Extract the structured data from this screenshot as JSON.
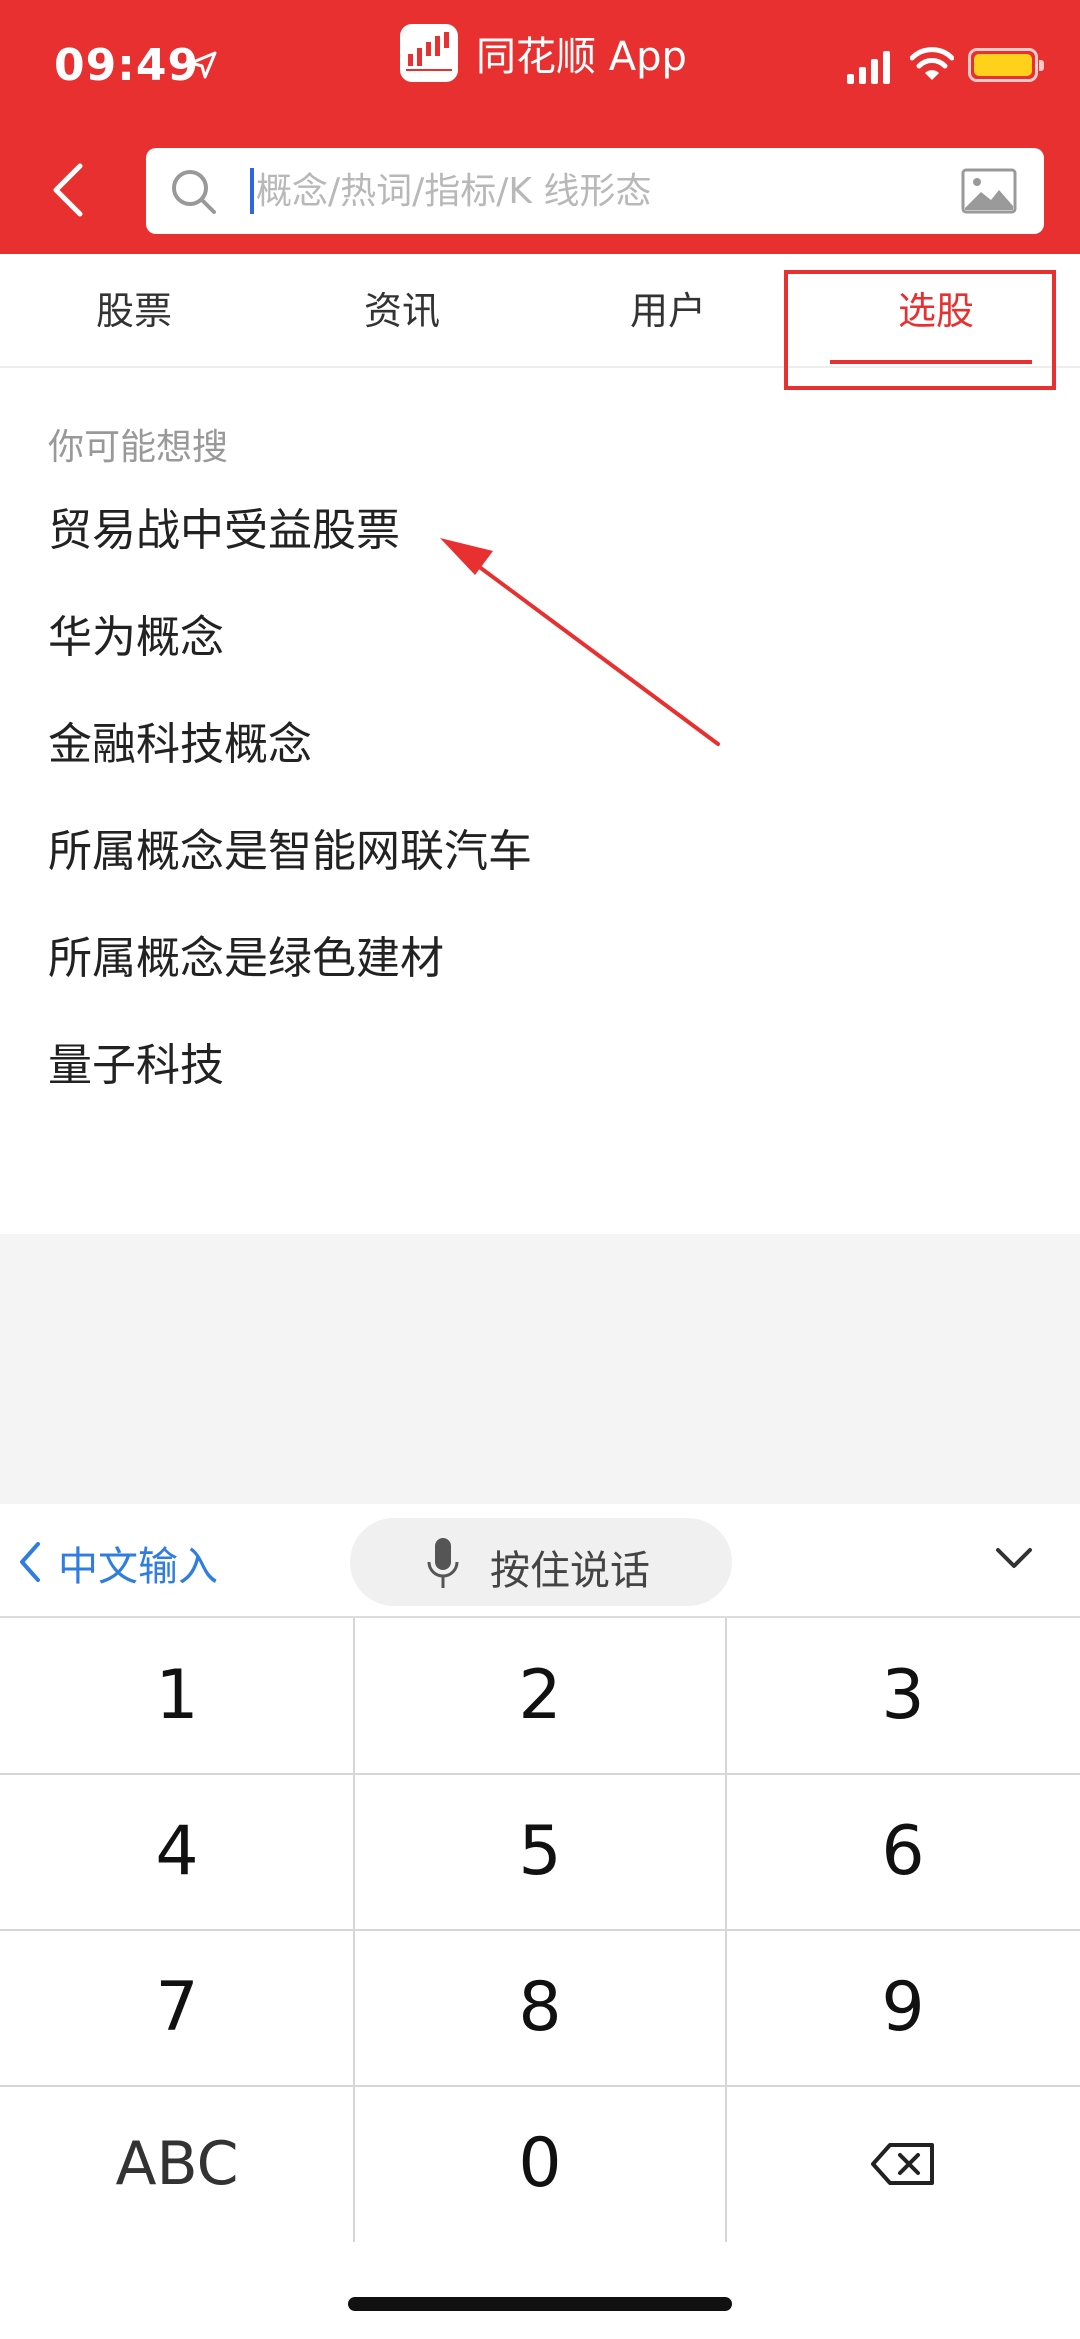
{
  "status_bar": {
    "time": "09:49",
    "battery_color": "#ffd11a"
  },
  "header": {
    "app_title": "同花顺 App",
    "brand_color": "#e93030"
  },
  "search": {
    "placeholder": "概念/热词/指标/K 线形态",
    "value": ""
  },
  "tabs": [
    {
      "label": "股票",
      "active": false
    },
    {
      "label": "资讯",
      "active": false
    },
    {
      "label": "用户",
      "active": false
    },
    {
      "label": "选股",
      "active": true
    }
  ],
  "suggestions": {
    "label": "你可能想搜",
    "items": [
      "贸易战中受益股票",
      "华为概念",
      "金融科技概念",
      "所属概念是智能网联汽车",
      "所属概念是绿色建材",
      "量子科技"
    ]
  },
  "keyboard": {
    "lang_label": "中文输入",
    "voice_label": "按住说话",
    "keys": [
      "1",
      "2",
      "3",
      "4",
      "5",
      "6",
      "7",
      "8",
      "9",
      "ABC",
      "0",
      "⌫"
    ]
  }
}
